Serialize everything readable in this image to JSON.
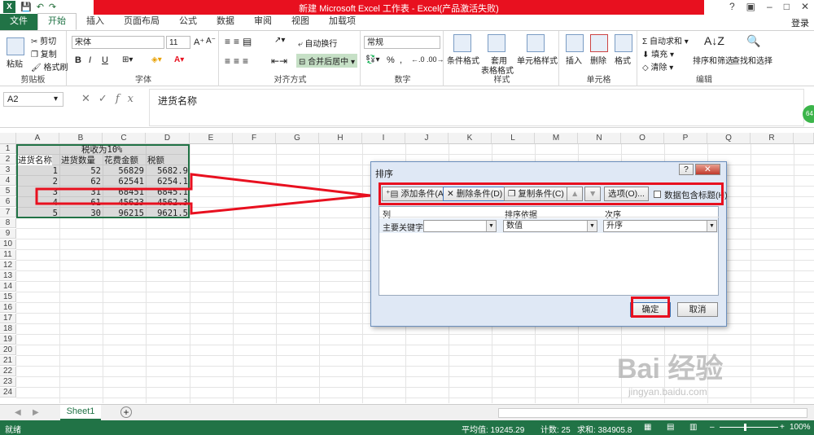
{
  "window": {
    "title": "新建 Microsoft Excel 工作表 - Excel(产品激活失败)",
    "login": "登录"
  },
  "tabs": [
    "文件",
    "开始",
    "插入",
    "页面布局",
    "公式",
    "数据",
    "审阅",
    "视图",
    "加载项"
  ],
  "ribbon": {
    "clipboard": {
      "label": "剪贴板",
      "paste": "粘贴",
      "cut": "剪切",
      "copy": "复制",
      "format_painter": "格式刷"
    },
    "font": {
      "label": "字体",
      "name": "宋体",
      "size": "11",
      "bold": "B",
      "italic": "I",
      "underline": "U"
    },
    "alignment": {
      "label": "对齐方式",
      "wrap": "自动换行",
      "merge": "合并后居中"
    },
    "number": {
      "label": "数字",
      "format": "常规",
      "percent": "%",
      "comma": ","
    },
    "styles": {
      "label": "样式",
      "conditional": "条件格式",
      "table_line1": "套用",
      "table_line2": "表格格式",
      "cell_style": "单元格样式"
    },
    "cells": {
      "label": "单元格",
      "insert": "插入",
      "delete": "删除",
      "format": "格式"
    },
    "editing": {
      "label": "编辑",
      "autosum": "自动求和",
      "fill": "填充",
      "clear": "清除",
      "sort_filter": "排序和筛选",
      "find_select": "查找和选择"
    }
  },
  "formula_bar": {
    "name_box": "A2",
    "content": "进货名称",
    "fx": "fx"
  },
  "columns": [
    "A",
    "B",
    "C",
    "D",
    "E",
    "F",
    "G",
    "H",
    "I",
    "J",
    "K",
    "L",
    "M",
    "N",
    "O",
    "P",
    "Q",
    "R"
  ],
  "rows": [
    "1",
    "2",
    "3",
    "4",
    "5",
    "6",
    "7",
    "8",
    "9",
    "10",
    "11",
    "12",
    "13",
    "14",
    "15",
    "16",
    "17",
    "18",
    "19",
    "20",
    "21",
    "22",
    "23",
    "24"
  ],
  "cells": {
    "title": "税收为10%",
    "headers": [
      "进货名称",
      "进货数量",
      "花费金额",
      "税额"
    ],
    "data": [
      [
        "1",
        "52",
        "56829",
        "5682.9"
      ],
      [
        "2",
        "62",
        "62541",
        "6254.1"
      ],
      [
        "3",
        "31",
        "68451",
        "6845.1"
      ],
      [
        "4",
        "61",
        "45623",
        "4562.3"
      ],
      [
        "5",
        "30",
        "96215",
        "9621.5"
      ]
    ]
  },
  "sheet": {
    "name": "Sheet1",
    "add": "+"
  },
  "status": {
    "ready": "就绪",
    "average": "平均值: 19245.29",
    "count": "计数: 25",
    "sum": "求和: 384905.8",
    "zoom": "100%"
  },
  "dialog": {
    "title": "排序",
    "help": "?",
    "close": "✕",
    "add_level": "添加条件(A)",
    "delete_level": "删除条件(D)",
    "copy_level": "复制条件(C)",
    "options": "选项(O)...",
    "has_headers": "数据包含标题(H)",
    "col_header": "列",
    "sort_on_header": "排序依据",
    "order_header": "次序",
    "primary_key": "主要关键字",
    "sort_on_value": "数值",
    "order_value": "升序",
    "ok": "确定",
    "cancel": "取消"
  },
  "watermark": {
    "main": "Bai 经验",
    "sub": "jingyan.baidu.com"
  },
  "colors": {
    "excel_green": "#217346",
    "title_red": "#e8101f",
    "annotation_red": "#e8101f"
  }
}
